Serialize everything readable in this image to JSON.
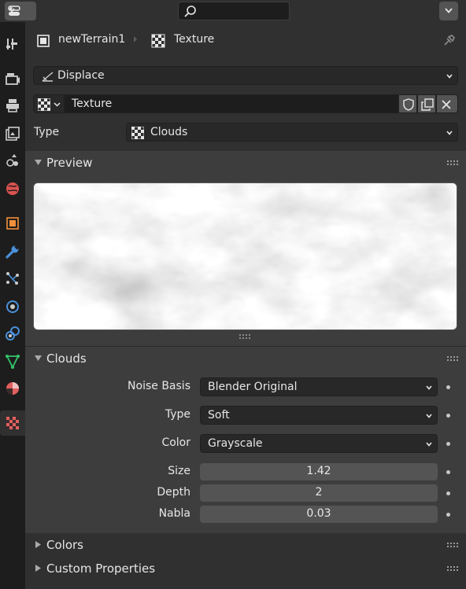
{
  "header": {
    "editor_type_icon": "properties-editor-icon",
    "search_placeholder": "",
    "menu_icon": "chevron-down-icon"
  },
  "tabs": [
    {
      "name": "tool",
      "icon": "tool-icon",
      "color": "#cccccc"
    },
    {
      "name": "render",
      "icon": "render-icon",
      "color": "#cccccc"
    },
    {
      "name": "output",
      "icon": "output-icon",
      "color": "#cccccc"
    },
    {
      "name": "view-layer",
      "icon": "view-layer-icon",
      "color": "#cccccc"
    },
    {
      "name": "scene",
      "icon": "scene-icon",
      "color": "#cccccc"
    },
    {
      "name": "world",
      "icon": "world-icon",
      "color": "#d9534f"
    },
    {
      "name": "object",
      "icon": "object-icon",
      "color": "#f0903a"
    },
    {
      "name": "modifier",
      "icon": "wrench-icon",
      "color": "#4a90d9"
    },
    {
      "name": "particles",
      "icon": "particles-icon",
      "color": "#4a90d9"
    },
    {
      "name": "physics",
      "icon": "physics-icon",
      "color": "#4a90d9"
    },
    {
      "name": "constraints",
      "icon": "constraint-icon",
      "color": "#4a90d9"
    },
    {
      "name": "data",
      "icon": "mesh-data-icon",
      "color": "#33c46a"
    },
    {
      "name": "material",
      "icon": "material-icon",
      "color": "#e06060"
    },
    {
      "name": "texture",
      "icon": "texture-icon",
      "color": "#e06060"
    }
  ],
  "breadcrumb": {
    "object": "newTerrain1",
    "texture": "Texture"
  },
  "modifier": {
    "value": "Displace"
  },
  "texture_block": {
    "name": "Texture"
  },
  "type_row": {
    "label": "Type",
    "value": "Clouds"
  },
  "panels": {
    "preview": "Preview",
    "clouds": "Clouds",
    "colors": "Colors",
    "custom": "Custom Properties"
  },
  "clouds": {
    "noise_basis": {
      "label": "Noise Basis",
      "value": "Blender Original"
    },
    "type": {
      "label": "Type",
      "value": "Soft"
    },
    "color": {
      "label": "Color",
      "value": "Grayscale"
    },
    "size": {
      "label": "Size",
      "value": "1.42"
    },
    "depth": {
      "label": "Depth",
      "value": "2"
    },
    "nabla": {
      "label": "Nabla",
      "value": "0.03"
    }
  }
}
